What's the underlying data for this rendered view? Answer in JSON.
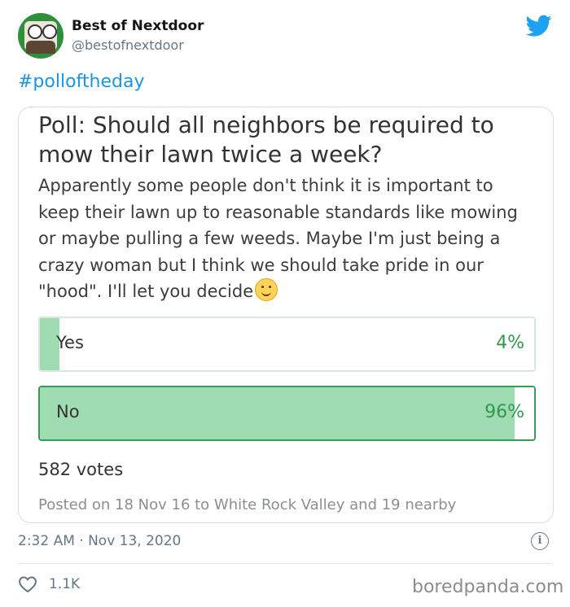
{
  "tweet": {
    "display_name": "Best of Nextdoor",
    "handle": "@bestofnextdoor",
    "hashtag": "#polloftheday",
    "timestamp": "2:32 AM · Nov 13, 2020",
    "likes": "1.1K"
  },
  "poll": {
    "title": "Poll: Should all neighbors be required to mow their lawn twice a week?",
    "description": "Apparently some people don't think it is important to keep their lawn up to reasonable standards like mowing or maybe pulling a few weeds. Maybe I'm just being a crazy woman but I think we should take pride in our \"hood\". I'll let you decide",
    "options": [
      {
        "label": "Yes",
        "percent": "4%",
        "fraction": 0.04
      },
      {
        "label": "No",
        "percent": "96%",
        "fraction": 0.96
      }
    ],
    "votes": "582 votes",
    "posted": "Posted on 18 Nov 16 to White Rock Valley and 19 nearby"
  },
  "watermark": "boredpanda.com",
  "colors": {
    "accent": "#1b95e0",
    "poll_fill": "#9fdcb2",
    "poll_text": "#2e9a4e"
  },
  "icons": [
    "twitter-bird-icon",
    "smiling-emoji-icon",
    "info-icon",
    "heart-icon"
  ]
}
